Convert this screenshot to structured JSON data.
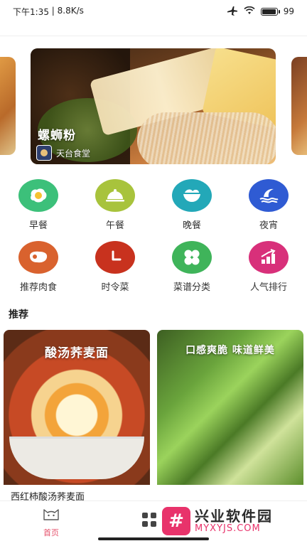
{
  "status_bar": {
    "time": "下午1:35",
    "speed": "8.8K/s",
    "battery": "99",
    "battery_level": 0.99,
    "icons": [
      "airplane-icon",
      "wifi-icon",
      "battery-icon"
    ]
  },
  "banner": {
    "title": "螺蛳粉",
    "source": "天台食堂"
  },
  "categories": [
    {
      "label": "早餐",
      "icon": "egg-icon",
      "color": "#3cc07a"
    },
    {
      "label": "午餐",
      "icon": "cloche-icon",
      "color": "#a8c33c"
    },
    {
      "label": "晚餐",
      "icon": "bowl-icon",
      "color": "#23a8b8"
    },
    {
      "label": "夜宵",
      "icon": "moon-wave-icon",
      "color": "#2f5bd3"
    },
    {
      "label": "推荐肉食",
      "icon": "meat-icon",
      "color": "#d9622e"
    },
    {
      "label": "时令菜",
      "icon": "clock-icon",
      "color": "#c8321e"
    },
    {
      "label": "菜谱分类",
      "icon": "grid-icon",
      "color": "#3fb45a"
    },
    {
      "label": "人气排行",
      "icon": "ranking-icon",
      "color": "#d8307a"
    }
  ],
  "section": {
    "title": "推荐"
  },
  "recipes": [
    {
      "overlay": "酸汤荞麦面",
      "title": "西红柿酸汤荞麦面"
    },
    {
      "overlay": "口感爽脆 味道鲜美",
      "title": ""
    }
  ],
  "nav": {
    "home_label": "首页"
  },
  "watermark": {
    "logo": "#",
    "cn": "兴业软件园",
    "en": "MYXYJS.COM"
  },
  "colors": {
    "accent": "#e5506a",
    "watermark": "#e8336b"
  }
}
